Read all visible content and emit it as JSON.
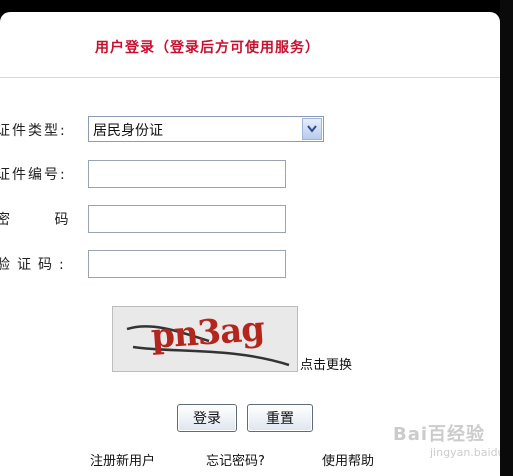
{
  "header": {
    "title": "用户登录（登录后方可使用服务）"
  },
  "form": {
    "id_type_label": "证件类型:",
    "id_type_value": "居民身份证",
    "id_number_label": "证件编号:",
    "password_label": "密 码:",
    "captcha_label": "验证码:"
  },
  "captcha": {
    "text": "pn3ag",
    "refresh_label": "点击更换"
  },
  "buttons": {
    "login": "登录",
    "reset": "重置"
  },
  "footer": {
    "register": "注册新用户",
    "forgot": "忘记密码?",
    "help": "使用帮助"
  },
  "watermark": {
    "text": "Bai百经验",
    "sub": "jingyan.baidu.com"
  },
  "colors": {
    "title": "#c8102e",
    "captcha_text": "#b3261e"
  }
}
